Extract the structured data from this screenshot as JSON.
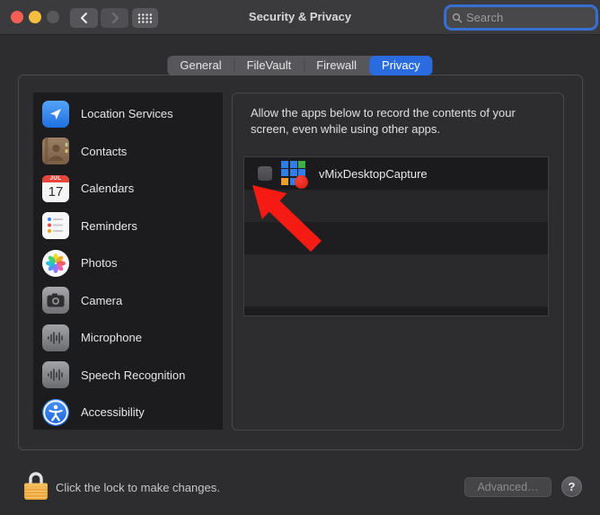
{
  "titlebar": {
    "title": "Security & Privacy",
    "search_placeholder": "Search"
  },
  "tabs": [
    {
      "label": "General",
      "selected": false
    },
    {
      "label": "FileVault",
      "selected": false
    },
    {
      "label": "Firewall",
      "selected": false
    },
    {
      "label": "Privacy",
      "selected": true
    }
  ],
  "sidebar": {
    "items": [
      {
        "label": "Location Services",
        "icon": "location-arrow-icon"
      },
      {
        "label": "Contacts",
        "icon": "contacts-book-icon"
      },
      {
        "label": "Calendars",
        "icon": "calendar-icon"
      },
      {
        "label": "Reminders",
        "icon": "reminders-list-icon"
      },
      {
        "label": "Photos",
        "icon": "photos-flower-icon"
      },
      {
        "label": "Camera",
        "icon": "camera-icon"
      },
      {
        "label": "Microphone",
        "icon": "waveform-icon"
      },
      {
        "label": "Speech Recognition",
        "icon": "waveform-icon"
      },
      {
        "label": "Accessibility",
        "icon": "accessibility-figure-icon"
      }
    ]
  },
  "calendar_icon": {
    "month": "JUL",
    "day": "17"
  },
  "privacy_panel": {
    "description": "Allow the apps below to record the contents of your screen, even while using other apps.",
    "apps": [
      {
        "name": "vMixDesktopCapture",
        "checked": false
      }
    ],
    "annotation": "red-arrow-pointing-at-checkbox"
  },
  "footer": {
    "lock_message": "Click the lock to make changes.",
    "advanced_label": "Advanced…",
    "help_label": "?"
  },
  "colors": {
    "accent_blue": "#2a6ce0",
    "arrow_red": "#f51a12",
    "lock_orange": "#eea53c",
    "traffic_red": "#f35f54",
    "traffic_yellow": "#f6be40",
    "sidebar_bg": "#1c1c1e",
    "window_bg": "#2d2d2f",
    "titlebar_bg": "#3b3b3d"
  }
}
